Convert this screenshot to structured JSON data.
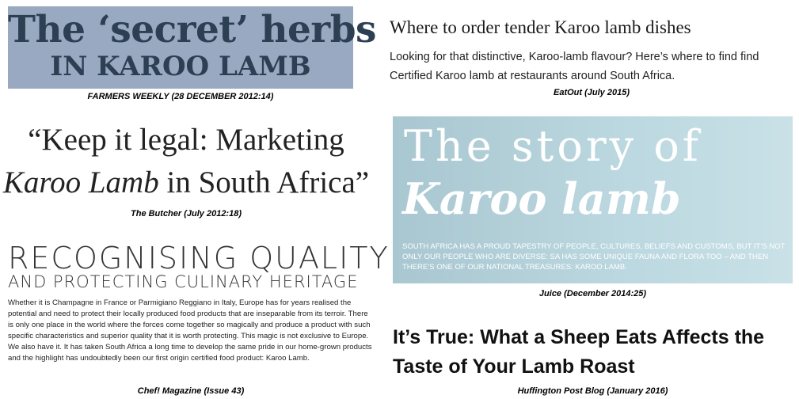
{
  "farmers_weekly": {
    "headline_line1": "The ‘secret’ herbs",
    "headline_line2": "IN KAROO LAMB",
    "caption": "FARMERS WEEKLY (28 DECEMBER 2012:14)",
    "bg_color": "#9aa9c2"
  },
  "eatout": {
    "title": "Where to order tender Karoo lamb dishes",
    "body": "Looking for that distinctive, Karoo-lamb flavour? Here’s where to find find Certified Karoo lamb at restaurants around South Africa.",
    "caption": "EatOut (July 2015)"
  },
  "butcher": {
    "quote_part1": "“Keep it legal: Marketing",
    "quote_italic": "Karoo Lamb",
    "quote_part2": " in South Africa”",
    "caption": "The Butcher (July 2012:18)"
  },
  "juice": {
    "title_line1": "The story of",
    "title_line2": "Karoo lamb",
    "body": "SOUTH AFRICA HAS A PROUD TAPESTRY OF PEOPLE, CULTURES, BELIEFS AND CUSTOMS, BUT IT’S NOT ONLY OUR PEOPLE WHO ARE DIVERSE: SA HAS SOME UNIQUE FAUNA AND FLORA TOO – AND THEN THERE’S ONE OF OUR NATIONAL TREASURES: KAROO LAMB.",
    "caption": "Juice (December 2014:25)",
    "bg_color": "#bcd8e0"
  },
  "chef": {
    "headline_line1": "RECOGNISING QUALITY",
    "headline_line2": "AND PROTECTING CULINARY HERITAGE",
    "body": "Whether it is Champagne in France or Parmigiano Reggiano in Italy, Europe has for years realised the potential and need to protect their locally produced food products that are inseparable from its terroir. There is only one place in the world where the forces come together so magically and produce a product with such specific characteristics and superior quality that it is worth protecting. This magic is not exclusive to Europe. We also have it. It has taken South Africa a long time to develop the same pride in our home-grown products and the highlight has undoubtedly been our first origin certified food product: Karoo Lamb.",
    "caption": "Chef! Magazine (Issue 43)"
  },
  "huffington": {
    "title_line1": "It’s True: What a Sheep Eats Affects the",
    "title_line2": "Taste of Your Lamb Roast",
    "caption": "Huffington Post Blog (January 2016)"
  }
}
